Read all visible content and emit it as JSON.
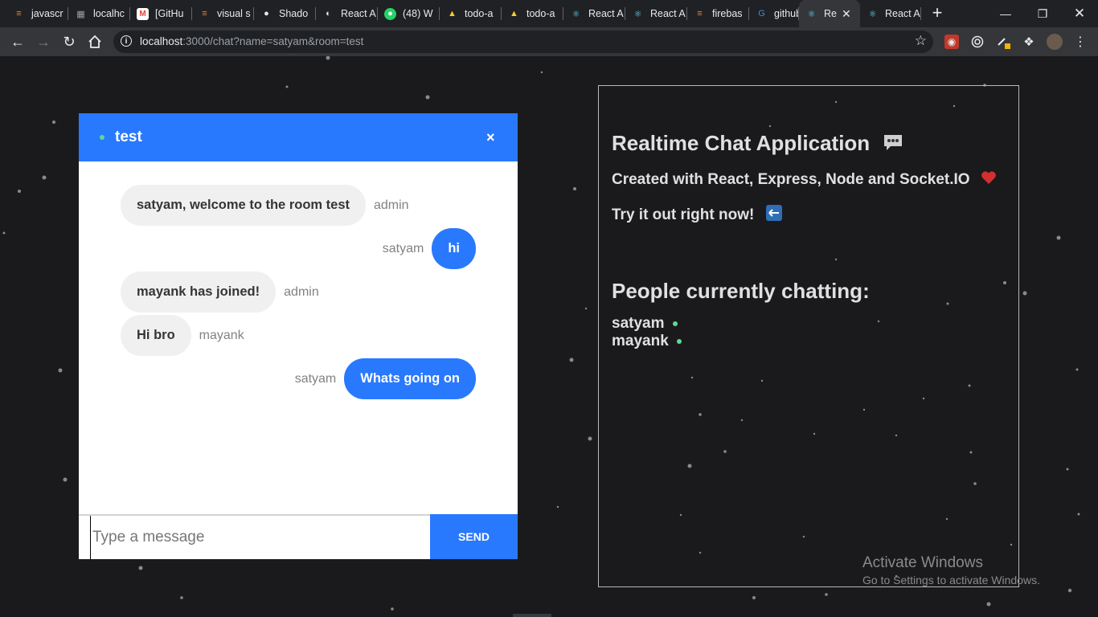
{
  "browser": {
    "tabs": [
      {
        "label": "javascr",
        "icon": "stackoverflow-icon",
        "color": "#f48024"
      },
      {
        "label": "localhc",
        "icon": "localhost-icon",
        "color": "#9aa0a6"
      },
      {
        "label": "[GitHu",
        "icon": "gmail-icon",
        "color": "#ea4335"
      },
      {
        "label": "visual s",
        "icon": "stackoverflow-icon",
        "color": "#f48024"
      },
      {
        "label": "Shado",
        "icon": "github-icon",
        "color": "#e8eaed"
      },
      {
        "label": "React A",
        "icon": "globe-icon",
        "color": "#e8eaed"
      },
      {
        "label": "(48) W",
        "icon": "whatsapp-icon",
        "color": "#25d366"
      },
      {
        "label": "todo-a",
        "icon": "firebase-icon",
        "color": "#ffca28"
      },
      {
        "label": "todo-a",
        "icon": "firebase-icon",
        "color": "#ffca28"
      },
      {
        "label": "React A",
        "icon": "react-icon",
        "color": "#61dafb"
      },
      {
        "label": "React A",
        "icon": "react-icon",
        "color": "#61dafb"
      },
      {
        "label": "firebas",
        "icon": "stackoverflow-icon",
        "color": "#f48024"
      },
      {
        "label": "github",
        "icon": "google-icon",
        "color": "#4285f4"
      },
      {
        "label": "Re",
        "icon": "react-icon",
        "color": "#61dafb",
        "active": true
      },
      {
        "label": "React A",
        "icon": "react-icon",
        "color": "#61dafb"
      }
    ],
    "url_host": "localhost",
    "url_rest": ":3000/chat?name=satyam&room=test"
  },
  "chat": {
    "room": "test",
    "close_label": "×",
    "messages": [
      {
        "text": "satyam, welcome to the room test",
        "sender": "admin",
        "mine": false
      },
      {
        "text": "hi",
        "sender": "satyam",
        "mine": true
      },
      {
        "text": "mayank has joined!",
        "sender": "admin",
        "mine": false
      },
      {
        "text": "Hi bro",
        "sender": "mayank",
        "mine": false
      },
      {
        "text": "Whats going on",
        "sender": "satyam",
        "mine": true
      }
    ],
    "input_placeholder": "Type a message",
    "send_label": "SEND"
  },
  "info": {
    "title": "Realtime Chat Application",
    "created": "Created with React, Express, Node and Socket.IO",
    "try": "Try it out right now!",
    "people_title": "People currently chatting:",
    "people": [
      "satyam",
      "mayank"
    ]
  },
  "windows_watermark": {
    "line1": "Activate Windows",
    "line2": "Go to Settings to activate Windows."
  },
  "colors": {
    "accent": "#2979ff",
    "online": "#5cdb95",
    "background": "#1a1a1d"
  }
}
